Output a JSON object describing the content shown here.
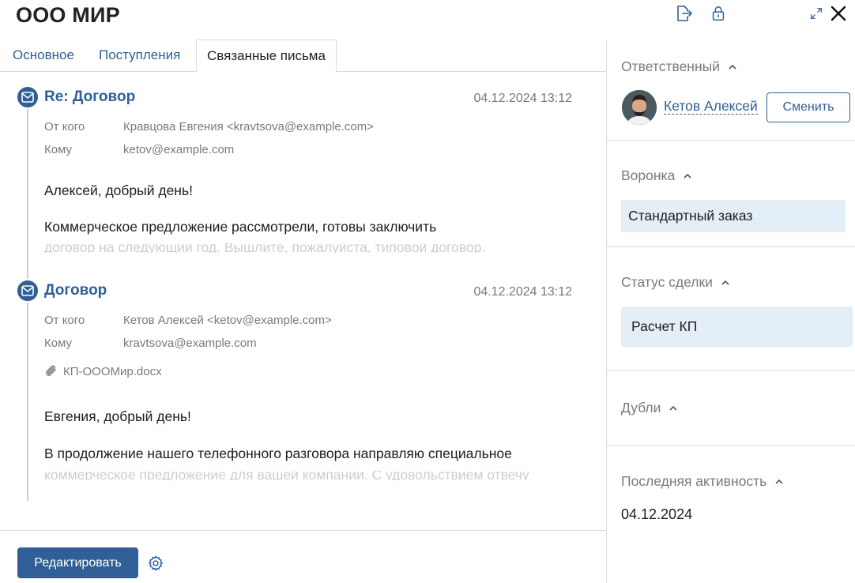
{
  "header": {
    "title": "ООО МИР"
  },
  "tabs": [
    {
      "label": "Основное"
    },
    {
      "label": "Поступления"
    },
    {
      "label": "Связанные письма",
      "active": true
    }
  ],
  "emails": [
    {
      "subject": "Re: Договор",
      "date": "04.12.2024 13:12",
      "from_label": "От кого",
      "from": "Кравцова Евгения <kravtsova@example.com>",
      "to_label": "Кому",
      "to": "ketov@example.com",
      "greeting": "Алексей, добрый день!",
      "text": "Коммерческое предложение рассмотрели, готовы заключить",
      "text_faded": "договор на следующий год. Вышлите, пожалуйста, типовой договор."
    },
    {
      "subject": "Договор",
      "date": "04.12.2024 13:12",
      "from_label": "От кого",
      "from": "Кетов Алексей <ketov@example.com>",
      "to_label": "Кому",
      "to": "kravtsova@example.com",
      "attachment": "КП-OOOМир.docx",
      "greeting": "Евгения, добрый день!",
      "text": "В продолжение нашего телефонного разговора направляю специальное",
      "text_faded": "коммерческое предложение для вашей компании. С удовольствием отвечу"
    }
  ],
  "footer": {
    "edit_label": "Редактировать"
  },
  "sidebar": {
    "responsible": {
      "label": "Ответственный",
      "name": "Кетов Алексей",
      "change_label": "Сменить"
    },
    "funnel": {
      "label": "Воронка",
      "value": "Стандартный заказ"
    },
    "status": {
      "label": "Статус сделки",
      "value": "Расчет КП"
    },
    "duplicates": {
      "label": "Дубли"
    },
    "last_activity": {
      "label": "Последняя активность",
      "value": "04.12.2024"
    }
  },
  "colors": {
    "accent": "#2f5f96",
    "field_bg": "#e3eef7",
    "muted_text": "#7a7a7a",
    "border": "#dcdcdc"
  },
  "icons": [
    "export-icon",
    "lock-icon",
    "expand-icon",
    "close-icon",
    "envelope-icon",
    "paperclip-icon",
    "gear-icon",
    "chevron-up-icon"
  ]
}
